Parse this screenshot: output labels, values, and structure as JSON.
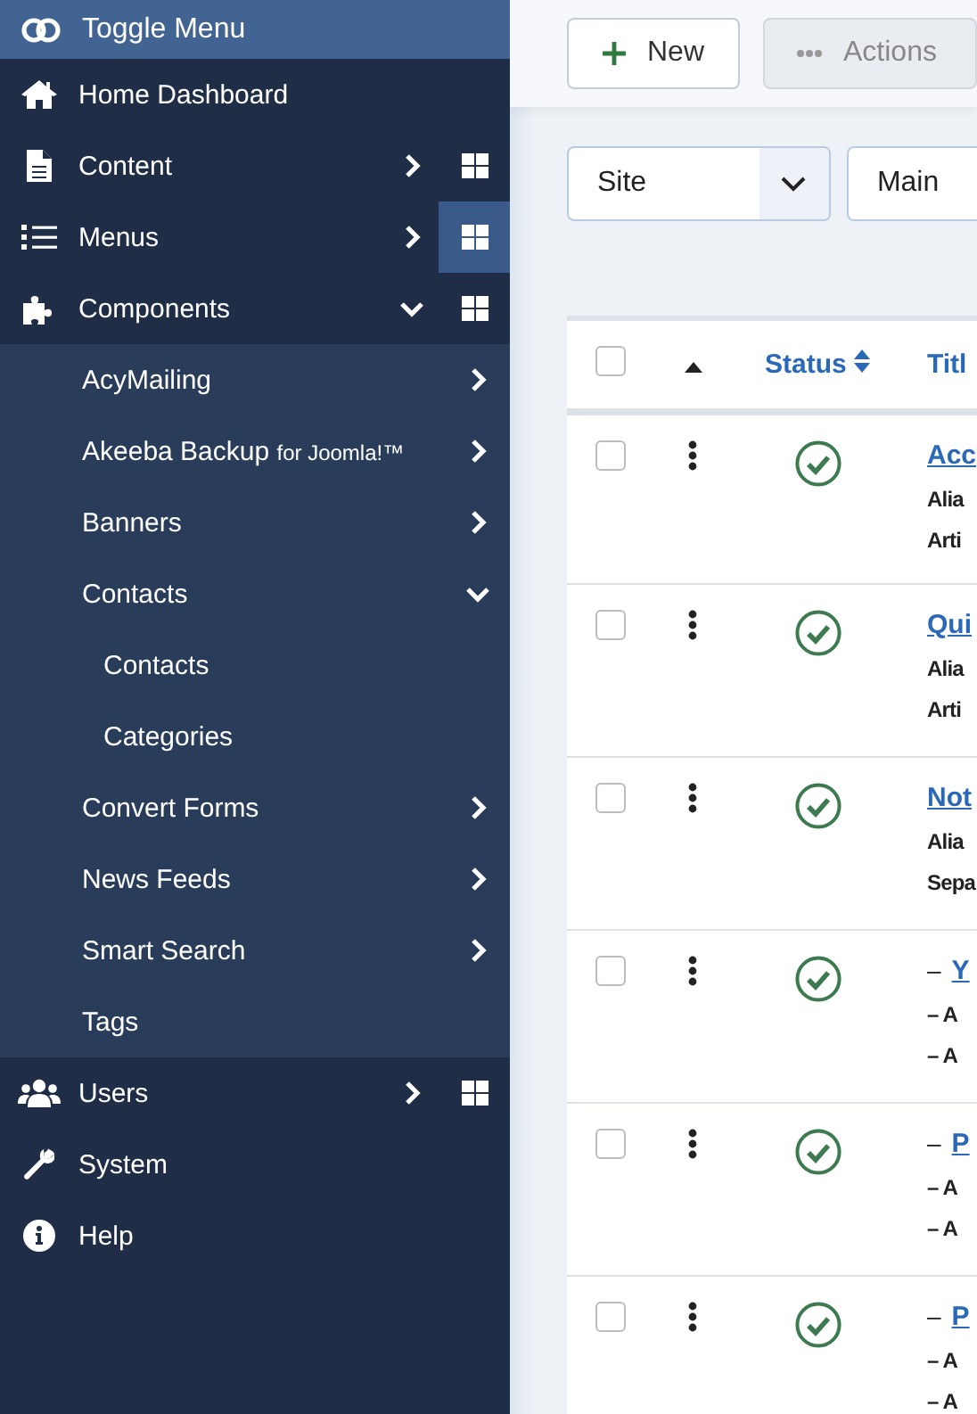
{
  "sidebar": {
    "toggle": {
      "label": "Toggle Menu"
    },
    "items": [
      {
        "label": "Home Dashboard",
        "expandable": false
      },
      {
        "label": "Content",
        "expandable": true,
        "expanded": false,
        "dashboard_selected": false
      },
      {
        "label": "Menus",
        "expandable": true,
        "expanded": false,
        "dashboard_selected": true
      },
      {
        "label": "Components",
        "expandable": true,
        "expanded": true,
        "dashboard_selected": false,
        "children": [
          {
            "label": "AcyMailing",
            "expandable": true,
            "expanded": false
          },
          {
            "label": "Akeeba Backup",
            "suffix": "for Joomla!™",
            "expandable": true,
            "expanded": false
          },
          {
            "label": "Banners",
            "expandable": true,
            "expanded": false
          },
          {
            "label": "Contacts",
            "expandable": true,
            "expanded": true,
            "children": [
              {
                "label": "Contacts"
              },
              {
                "label": "Categories"
              }
            ]
          },
          {
            "label": "Convert Forms",
            "expandable": true,
            "expanded": false
          },
          {
            "label": "News Feeds",
            "expandable": true,
            "expanded": false
          },
          {
            "label": "Smart Search",
            "expandable": true,
            "expanded": false
          },
          {
            "label": "Tags",
            "expandable": false
          }
        ]
      },
      {
        "label": "Users",
        "expandable": true,
        "expanded": false,
        "dashboard_selected": false
      },
      {
        "label": "System",
        "expandable": false
      },
      {
        "label": "Help",
        "expandable": false
      }
    ]
  },
  "toolbar": {
    "new_button": "New",
    "actions_button": "Actions"
  },
  "filters": [
    {
      "value": "Site",
      "kind": "select"
    },
    {
      "value": "Main",
      "kind": "cut"
    }
  ],
  "table": {
    "columns": [
      {
        "kind": "checkbox",
        "checked": false
      },
      {
        "kind": "order"
      },
      {
        "kind": "sort",
        "label": "Status"
      },
      {
        "kind": "link",
        "label": "Titl"
      }
    ],
    "rows": [
      {
        "checked": false,
        "published": true,
        "title": "Acc",
        "lines": [
          "Alia",
          "Arti"
        ]
      },
      {
        "checked": false,
        "published": true,
        "title": "Qui",
        "lines": [
          "Alia",
          "Arti"
        ]
      },
      {
        "checked": false,
        "published": true,
        "title": "Not",
        "lines": [
          "Alia",
          "Sepa"
        ]
      },
      {
        "checked": false,
        "published": true,
        "prefix": "–",
        "title": "Y",
        "lines": [
          "– A",
          "– A"
        ]
      },
      {
        "checked": false,
        "published": true,
        "prefix": "–",
        "title": "P",
        "lines": [
          "– A",
          "– A"
        ]
      },
      {
        "checked": false,
        "published": true,
        "prefix": "–",
        "title": "P",
        "lines": [
          "– A",
          "– A"
        ]
      }
    ]
  }
}
